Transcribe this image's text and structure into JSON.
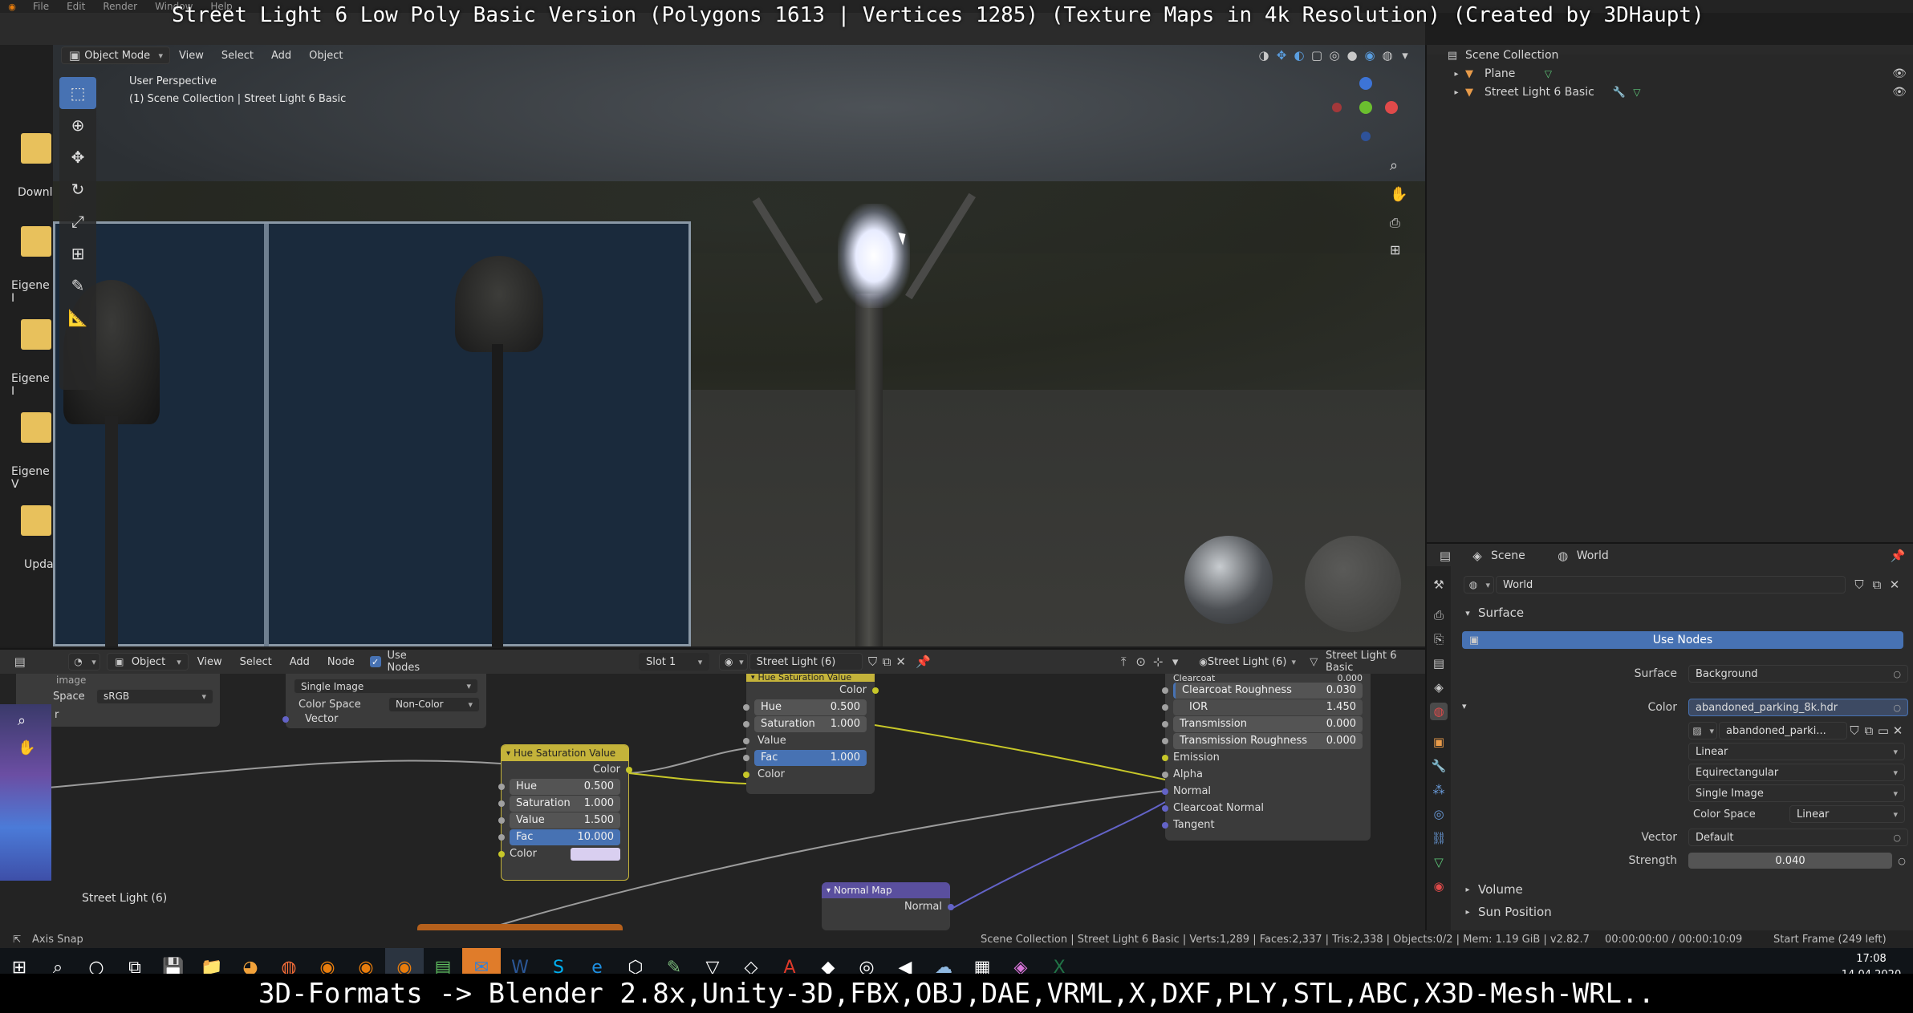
{
  "overlay": {
    "title": "Street Light 6 Low Poly Basic Version (Polygons 1613 | Vertices 1285) (Texture Maps in 4k Resolution) (Created by 3DHaupt)",
    "caption": "3D-Formats -> Blender 2.8x,Unity-3D,FBX,OBJ,DAE,VRML,X,DXF,PLY,STL,ABC,X3D-Mesh-WRL.."
  },
  "top_menu": {
    "file": "File",
    "edit": "Edit",
    "render": "Render",
    "window": "Window",
    "help": "Help"
  },
  "viewport": {
    "mode": "Object Mode",
    "menus": [
      "View",
      "Select",
      "Add",
      "Object"
    ],
    "perspective": "User Perspective",
    "collection_path": "(1) Scene Collection | Street Light 6 Basic"
  },
  "desktop": {
    "items": [
      "Downl",
      "Eigene I",
      "Eigene I",
      "Eigene V",
      "Upda"
    ]
  },
  "outliner": {
    "root": "Scene Collection",
    "items": [
      "Plane",
      "Street Light 6 Basic"
    ]
  },
  "properties": {
    "tabs": {
      "scene": "Scene",
      "world": "World"
    },
    "world_name": "World",
    "surface_panel": "Surface",
    "use_nodes": "Use Nodes",
    "surface_label": "Surface",
    "surface_value": "Background",
    "color_label": "Color",
    "color_value": "abandoned_parking_8k.hdr",
    "image_name": "abandoned_parki...",
    "interp": "Linear",
    "projection": "Equirectangular",
    "source": "Single Image",
    "colorspace_label": "Color Space",
    "colorspace_value": "Linear",
    "vector_label": "Vector",
    "vector_value": "Default",
    "strength_label": "Strength",
    "strength_value": "0.040",
    "volume": "Volume",
    "sun_position": "Sun Position"
  },
  "node_editor": {
    "type": "Object",
    "menus": [
      "View",
      "Select",
      "Add",
      "Node"
    ],
    "use_nodes": "Use Nodes",
    "slot": "Slot 1",
    "material": "Street Light (6)",
    "material_right": "Street Light (6)",
    "object_right": "Street Light 6 Basic",
    "footer_label": "Street Light (6)",
    "left_node": {
      "image": "image",
      "space_label": "Space",
      "space_value": "sRGB",
      "r_label": "r"
    },
    "tex_node": {
      "source": "Single Image",
      "cs_label": "Color Space",
      "cs_value": "Non-Color",
      "vector": "Vector"
    },
    "hsv1": {
      "title": "Hue Saturation Value",
      "out": "Color",
      "hue_l": "Hue",
      "hue_v": "0.500",
      "sat_l": "Saturation",
      "sat_v": "1.000",
      "val_l": "Value",
      "val_v": "1.500",
      "fac_l": "Fac",
      "fac_v": "10.000",
      "col_l": "Color"
    },
    "hsv2": {
      "title": "Hue Saturation Value",
      "out": "Color",
      "hue_l": "Hue",
      "hue_v": "0.500",
      "sat_l": "Saturation",
      "sat_v": "1.000",
      "val_l": "Value",
      "fac_l": "Fac",
      "fac_v": "1.000",
      "col_l": "Color"
    },
    "bsdf": {
      "clearcoat_l": "Clearcoat",
      "clearcoat_v": "0.000",
      "ccr_l": "Clearcoat Roughness",
      "ccr_v": "0.030",
      "ior_l": "IOR",
      "ior_v": "1.450",
      "tr_l": "Transmission",
      "tr_v": "0.000",
      "trr_l": "Transmission Roughness",
      "trr_v": "0.000",
      "emission": "Emission",
      "alpha": "Alpha",
      "normal": "Normal",
      "ccn": "Clearcoat Normal",
      "tangent": "Tangent"
    },
    "normal_map": {
      "title": "Normal Map",
      "out": "Normal"
    }
  },
  "status": {
    "axis_snap": "Axis Snap",
    "info": "Scene Collection | Street Light 6 Basic | Verts:1,289 | Faces:2,337 | Tris:2,338 | Objects:0/2 | Mem: 1.19 GiB | v2.82.7",
    "time": "00:00:00:00 / 00:00:10:09",
    "frame": "Start Frame (249 left)"
  },
  "taskbar": {
    "clock": "17:08",
    "date": "14.04.2020"
  },
  "colors": {
    "accent": "#4772b3",
    "header": "#303030",
    "panel": "#2b2b2b",
    "node": "#3b3b3b",
    "hsv_header": "#c4b33a",
    "normalmap_header": "#5a4f9e"
  }
}
